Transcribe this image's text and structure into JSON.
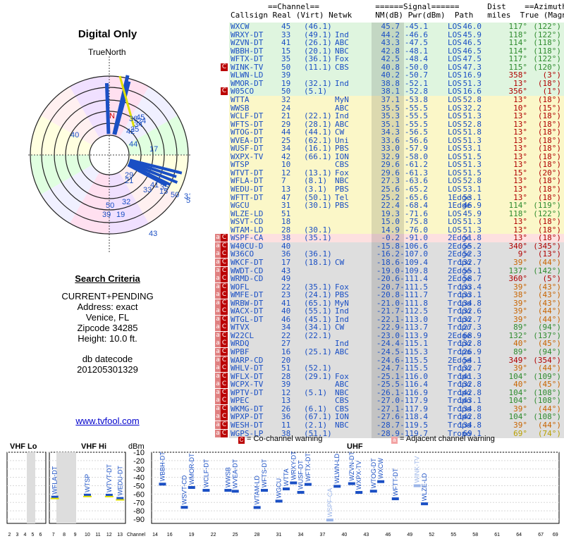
{
  "title": "Digital Only",
  "true_north": "TrueNorth",
  "search": {
    "heading": "Search Criteria",
    "lines": [
      "CURRENT+PENDING",
      "Address: exact",
      "Venice, FL",
      "Zipcode 34285",
      "Height: 10.0 ft."
    ],
    "db_label": "db datecode",
    "db_value": "201205301329"
  },
  "website": "www.tvfool.com",
  "table_header": {
    "line1": "        ==Channel==            ======Signal======      Dist    ==Azimuth==",
    "line2": "Callsign Real (Virt) Netwk     NM(dB) Pwr(dBm)  Path   miles  True (Magn)"
  },
  "colors": {
    "green": "#dff5df",
    "yellow": "#fbf7c8",
    "pink": "#fde0e0",
    "gray": "#dedede",
    "blue_text": "#1a4fc4",
    "warn": "#b00000"
  },
  "table": [
    [
      "WXCW",
      "45",
      "(46.1)",
      "",
      "45.7",
      "-45.1",
      "LOS",
      "46.0",
      "117°",
      "(122°)",
      "",
      "g"
    ],
    [
      "WRXY-DT",
      "33",
      "(49.1)",
      "Ind",
      "44.2",
      "-46.6",
      "LOS",
      "45.9",
      "118°",
      "(122°)",
      "",
      "g"
    ],
    [
      "WZVN-DT",
      "41",
      "(26.1)",
      "ABC",
      "43.3",
      "-47.5",
      "LOS",
      "46.5",
      "114°",
      "(118°)",
      "",
      "g"
    ],
    [
      "WBBH-DT",
      "15",
      "(20.1)",
      "NBC",
      "42.8",
      "-48.1",
      "LOS",
      "46.5",
      "114°",
      "(118°)",
      "",
      "g"
    ],
    [
      "WFTX-DT",
      "35",
      "(36.1)",
      "Fox",
      "42.5",
      "-48.4",
      "LOS",
      "47.5",
      "117°",
      "(122°)",
      "",
      "g"
    ],
    [
      "WINK-TV",
      "50",
      "(11.1)",
      "CBS",
      "40.8",
      "-50.0",
      "LOS",
      "47.3",
      "115°",
      "(120°)",
      "C",
      "g"
    ],
    [
      "WLWN-LD",
      "39",
      "",
      "",
      "40.2",
      "-50.7",
      "LOS",
      "16.9",
      "358°",
      "(3°)",
      "",
      "g"
    ],
    [
      "WMOR-DT",
      "19",
      "(32.1)",
      "Ind",
      "38.8",
      "-52.1",
      "LOS",
      "51.3",
      "13°",
      "(18°)",
      "",
      "g"
    ],
    [
      "W05CO",
      "50",
      "(5.1)",
      "",
      "38.1",
      "-52.8",
      "LOS",
      "16.6",
      "356°",
      "(1°)",
      "C",
      "g"
    ],
    [
      "WTTA",
      "32",
      "",
      "MyN",
      "37.1",
      "-53.8",
      "LOS",
      "52.8",
      "13°",
      "(18°)",
      "",
      "y"
    ],
    [
      "WWSB",
      "24",
      "",
      "ABC",
      "35.5",
      "-55.5",
      "LOS",
      "32.2",
      "10°",
      "(15°)",
      "",
      "y"
    ],
    [
      "WCLF-DT",
      "21",
      "(22.1)",
      "Ind",
      "35.3",
      "-55.5",
      "LOS",
      "51.3",
      "13°",
      "(18°)",
      "",
      "y"
    ],
    [
      "WFTS-DT",
      "29",
      "(28.1)",
      "ABC",
      "35.1",
      "-55.5",
      "LOS",
      "52.8",
      "13°",
      "(18°)",
      "",
      "y"
    ],
    [
      "WTOG-DT",
      "44",
      "(44.1)",
      "CW",
      "34.3",
      "-56.5",
      "LOS",
      "51.8",
      "13°",
      "(18°)",
      "",
      "y"
    ],
    [
      "WVEA-DT",
      "25",
      "(62.1)",
      "Uni",
      "33.6",
      "-56.6",
      "LOS",
      "51.3",
      "13°",
      "(18°)",
      "",
      "y"
    ],
    [
      "WUSF-DT",
      "34",
      "(16.1)",
      "PBS",
      "33.0",
      "-57.9",
      "LOS",
      "53.1",
      "13°",
      "(18°)",
      "",
      "y"
    ],
    [
      "WXPX-TV",
      "42",
      "(66.1)",
      "ION",
      "32.9",
      "-58.0",
      "LOS",
      "51.5",
      "13°",
      "(18°)",
      "",
      "y"
    ],
    [
      "WTSP",
      "10",
      "",
      "CBS",
      "29.6",
      "-61.2",
      "LOS",
      "51.3",
      "13°",
      "(18°)",
      "",
      "y"
    ],
    [
      "WTVT-DT",
      "12",
      "(13.1)",
      "Fox",
      "29.6",
      "-61.3",
      "LOS",
      "51.5",
      "15°",
      "(20°)",
      "",
      "y"
    ],
    [
      "WFLA-DT",
      "7",
      "(8.1)",
      "NBC",
      "27.3",
      "-63.6",
      "LOS",
      "52.8",
      "13°",
      "(18°)",
      "",
      "y"
    ],
    [
      "WEDU-DT",
      "13",
      "(3.1)",
      "PBS",
      "25.6",
      "-65.2",
      "LOS",
      "53.1",
      "13°",
      "(18°)",
      "",
      "y"
    ],
    [
      "WFTT-DT",
      "47",
      "(50.1)",
      "Tel",
      "25.2",
      "-65.6",
      "1Edge",
      "53.1",
      "13°",
      "(18°)",
      "",
      "y"
    ],
    [
      "WGCU",
      "31",
      "(30.1)",
      "PBS",
      "22.4",
      "-68.4",
      "1Edge",
      "46.9",
      "114°",
      "(119°)",
      "",
      "y"
    ],
    [
      "WLZE-LD",
      "51",
      "",
      "",
      "19.3",
      "-71.6",
      "LOS",
      "45.9",
      "118°",
      "(122°)",
      "",
      "y"
    ],
    [
      "WSVT-CD",
      "18",
      "",
      "",
      "15.0",
      "-75.8",
      "LOS",
      "51.3",
      "13°",
      "(18°)",
      "",
      "y"
    ],
    [
      "WTAM-LD",
      "28",
      "(30.1)",
      "",
      "14.9",
      "-76.0",
      "LOS",
      "51.3",
      "13°",
      "(18°)",
      "",
      "y"
    ],
    [
      "WSPF-CA",
      "38",
      "(35.1)",
      "",
      "-0.2",
      "-91.0",
      "2Edge",
      "51.8",
      "13°",
      "(18°)",
      "aC",
      "p"
    ],
    [
      "W40CU-D",
      "40",
      "",
      "",
      "-15.8",
      "-106.6",
      "2Edge",
      "55.2",
      "340°",
      "(345°)",
      "aC",
      "x"
    ],
    [
      "W36CO",
      "36",
      "(36.1)",
      "",
      "-16.2",
      "-107.0",
      "2Edge",
      "52.3",
      "9°",
      "(13°)",
      "aC",
      "x"
    ],
    [
      "WKCF-DT",
      "17",
      "(18.1)",
      "CW",
      "-18.6",
      "-109.4",
      "Tropo",
      "132.7",
      "39°",
      "(44°)",
      "aC",
      "x"
    ],
    [
      "WWDT-CD",
      "43",
      "",
      "",
      "-19.0",
      "-109.8",
      "2Edge",
      "55.1",
      "137°",
      "(142°)",
      "aC",
      "x"
    ],
    [
      "WRMD-CD",
      "49",
      "",
      "",
      "-20.6",
      "-111.4",
      "2Edge",
      "58.7",
      "360°",
      "(5°)",
      "aC",
      "x"
    ],
    [
      "WOFL",
      "22",
      "(35.1)",
      "Fox",
      "-20.7",
      "-111.5",
      "Tropo",
      "133.4",
      "39°",
      "(43°)",
      "aC",
      "x"
    ],
    [
      "WMFE-DT",
      "23",
      "(24.1)",
      "PBS",
      "-20.8",
      "-111.7",
      "Tropo",
      "133.1",
      "38°",
      "(43°)",
      "aC",
      "x"
    ],
    [
      "WRBW-DT",
      "41",
      "(65.1)",
      "MyN",
      "-21.0",
      "-111.8",
      "Tropo",
      "134.8",
      "39°",
      "(43°)",
      "aC",
      "x"
    ],
    [
      "WACX-DT",
      "40",
      "(55.1)",
      "Ind",
      "-21.7",
      "-112.5",
      "Tropo",
      "132.6",
      "39°",
      "(44°)",
      "aC",
      "x"
    ],
    [
      "WTGL-DT",
      "46",
      "(45.1)",
      "Ind",
      "-22.1",
      "-113.0",
      "Tropo",
      "132.7",
      "39°",
      "(44°)",
      "aC",
      "x"
    ],
    [
      "WTVX",
      "34",
      "(34.1)",
      "CW",
      "-22.9",
      "-113.7",
      "Tropo",
      "127.3",
      "89°",
      "(94°)",
      "aC",
      "x"
    ],
    [
      "W22CL",
      "22",
      "(22.1)",
      "",
      "-23.0",
      "-113.9",
      "2Edge",
      "68.9",
      "132°",
      "(137°)",
      "aC",
      "x"
    ],
    [
      "WRDQ",
      "27",
      "",
      "Ind",
      "-24.4",
      "-115.1",
      "Tropo",
      "132.8",
      "40°",
      "(45°)",
      "aC",
      "x"
    ],
    [
      "WPBF",
      "16",
      "(25.1)",
      "ABC",
      "-24.5",
      "-115.3",
      "Tropo",
      "126.9",
      "89°",
      "(94°)",
      "aC",
      "x"
    ],
    [
      "WARP-CD",
      "20",
      "",
      "",
      "-24.6",
      "-115.5",
      "2Edge",
      "54.1",
      "349°",
      "(354°)",
      "aC",
      "x"
    ],
    [
      "WHLV-DT",
      "51",
      "(52.1)",
      "",
      "-24.7",
      "-115.5",
      "Tropo",
      "132.7",
      "39°",
      "(44°)",
      "aC",
      "x"
    ],
    [
      "WFLX-DT",
      "28",
      "(29.1)",
      "Fox",
      "-25.1",
      "-116.0",
      "Tropo",
      "141.3",
      "104°",
      "(109°)",
      "aC",
      "x"
    ],
    [
      "WCPX-TV",
      "39",
      "",
      "ABC",
      "-25.5",
      "-116.4",
      "Tropo",
      "132.8",
      "40°",
      "(45°)",
      "aC",
      "x"
    ],
    [
      "WPTV-DT",
      "12",
      "(5.1)",
      "NBC",
      "-26.1",
      "-116.9",
      "Tropo",
      "142.8",
      "104°",
      "(108°)",
      "aC",
      "x"
    ],
    [
      "WPEC",
      "13",
      "",
      "CBS",
      "-27.0",
      "-117.9",
      "Tropo",
      "143.1",
      "104°",
      "(108°)",
      "aC",
      "x"
    ],
    [
      "WKMG-DT",
      "26",
      "(6.1)",
      "CBS",
      "-27.1",
      "-117.9",
      "Tropo",
      "134.8",
      "39°",
      "(44°)",
      "aC",
      "x"
    ],
    [
      "WPXP-DT",
      "36",
      "(67.1)",
      "ION",
      "-27.6",
      "-118.4",
      "Tropo",
      "142.8",
      "104°",
      "(108°)",
      "aC",
      "x"
    ],
    [
      "WESH-DT",
      "11",
      "(2.1)",
      "NBC",
      "-28.7",
      "-119.5",
      "Tropo",
      "134.8",
      "39°",
      "(44°)",
      "aC",
      "x"
    ],
    [
      "WGPS-LP",
      "38",
      "(51.1)",
      "",
      "-28.9",
      "-119.7",
      "Tropo",
      "69.1",
      "69°",
      "(74°)",
      "aC",
      "x"
    ]
  ],
  "legend": {
    "co_box": "C",
    "co_label": "= Co-channel warning",
    "adj_box": "a",
    "adj_label": "= Adjacent channel warning"
  },
  "chart_data": {
    "type": "bar",
    "ylabel": "dBm",
    "xlabel": "Channel",
    "ylim": [
      -95,
      -10
    ],
    "yticks": [
      -10,
      -20,
      -30,
      -40,
      -50,
      -60,
      -70,
      -80,
      -90
    ],
    "sections": [
      {
        "name": "VHF Lo",
        "xticks": [
          "2",
          "3",
          "4",
          "5",
          "6"
        ]
      },
      {
        "name": "VHF Hi",
        "xticks": [
          "7",
          "8",
          "9",
          "10",
          "11",
          "12",
          "13"
        ]
      },
      {
        "name": "UHF",
        "xticks": [
          "14",
          "16",
          "19",
          "22",
          "25",
          "28",
          "31",
          "34",
          "37",
          "40",
          "43",
          "46",
          "49",
          "52",
          "55",
          "58",
          "61",
          "64",
          "67",
          "69"
        ]
      }
    ],
    "bars": [
      {
        "label": "WFLA-DT",
        "channel": 7,
        "pwr": -63.6
      },
      {
        "label": "WTSP",
        "channel": 10,
        "pwr": -61.2
      },
      {
        "label": "WTVT-DT",
        "channel": 12,
        "pwr": -61.3
      },
      {
        "label": "WEDU-DT",
        "channel": 13,
        "pwr": -65.2
      },
      {
        "label": "WBBH-DT",
        "channel": 15,
        "pwr": -48.1
      },
      {
        "label": "WSVT-CD",
        "channel": 18,
        "pwr": -75.8
      },
      {
        "label": "WMOR-DT",
        "channel": 19,
        "pwr": -52.1
      },
      {
        "label": "WCLF-DT",
        "channel": 21,
        "pwr": -55.5
      },
      {
        "label": "WWSB",
        "channel": 24,
        "pwr": -55.5
      },
      {
        "label": "WVEA-DT",
        "channel": 25,
        "pwr": -56.6
      },
      {
        "label": "WTAM-LD",
        "channel": 28,
        "pwr": -76.0
      },
      {
        "label": "WFTS-DT",
        "channel": 29,
        "pwr": -55.5
      },
      {
        "label": "WGCU",
        "channel": 31,
        "pwr": -68.4
      },
      {
        "label": "WTTA",
        "channel": 32,
        "pwr": -53.8
      },
      {
        "label": "WRXY-DT",
        "channel": 33,
        "pwr": -46.6
      },
      {
        "label": "WUSF-DT",
        "channel": 34,
        "pwr": -57.9
      },
      {
        "label": "WFTX-DT",
        "channel": 35,
        "pwr": -48.4
      },
      {
        "label": "WSPF-CA",
        "channel": 38,
        "pwr": -91.0,
        "faint": true
      },
      {
        "label": "WLWN-LD",
        "channel": 39,
        "pwr": -50.7
      },
      {
        "label": "WZVN-DT",
        "channel": 41,
        "pwr": -47.5
      },
      {
        "label": "WXPX-TV",
        "channel": 42,
        "pwr": -58.0
      },
      {
        "label": "WTOG-DT",
        "channel": 44,
        "pwr": -56.5
      },
      {
        "label": "WXCW",
        "channel": 45,
        "pwr": -45.1
      },
      {
        "label": "WFTT-DT",
        "channel": 47,
        "pwr": -65.6
      },
      {
        "label": "WINK-TV",
        "channel": 50,
        "pwr": -50.0,
        "faint": true
      },
      {
        "label": "WLZE-LD",
        "channel": 51,
        "pwr": -71.6
      }
    ]
  },
  "radar_data": {
    "labels": [
      "40",
      "17",
      "50",
      "39",
      "19",
      "32",
      "21",
      "29",
      "44",
      "36",
      "45",
      "33",
      "41",
      "35",
      "50",
      "31",
      "51",
      "43",
      "15",
      "42",
      "25",
      "34",
      "24",
      "N"
    ]
  }
}
